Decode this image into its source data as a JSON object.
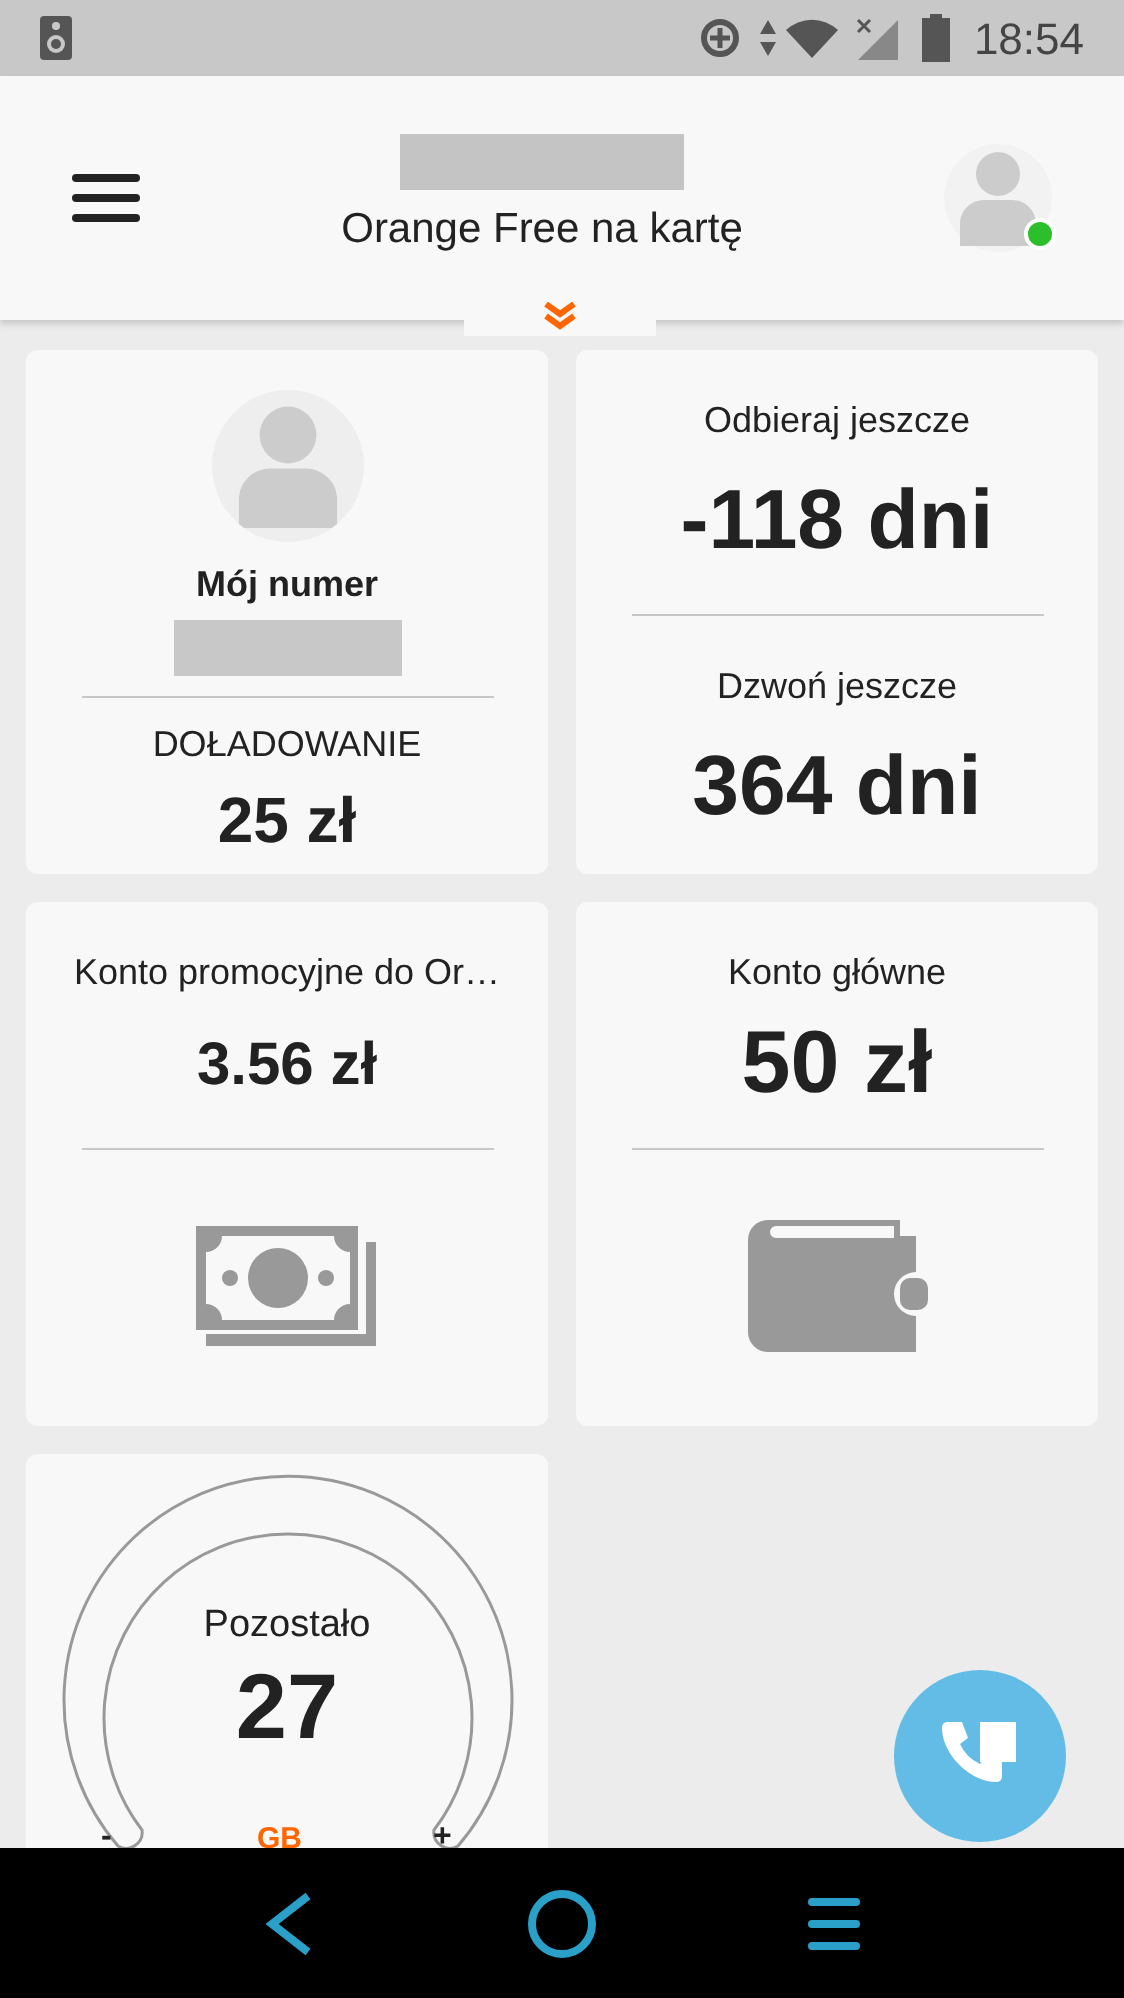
{
  "status_bar": {
    "time": "18:54"
  },
  "header": {
    "title": "Orange Free na kartę",
    "online": true
  },
  "number_card": {
    "label": "Mój numer",
    "topup_label": "DOŁADOWANIE",
    "topup_value": "25 zł"
  },
  "validity_card": [
    {
      "label": "Odbieraj jeszcze",
      "value": "-118 dni"
    },
    {
      "label": "Dzwoń jeszcze",
      "value": "364 dni"
    }
  ],
  "accounts": [
    {
      "kind": "cash",
      "label": "Konto promocyjne do Or…",
      "value": "3.56 zł",
      "emphasis": false
    },
    {
      "kind": "wallet",
      "label": "Konto główne",
      "value": "50 zł",
      "emphasis": true
    }
  ],
  "data_card": {
    "label": "Pozostało",
    "value": "27",
    "unit": "GB",
    "minus": "-",
    "plus": "+"
  }
}
